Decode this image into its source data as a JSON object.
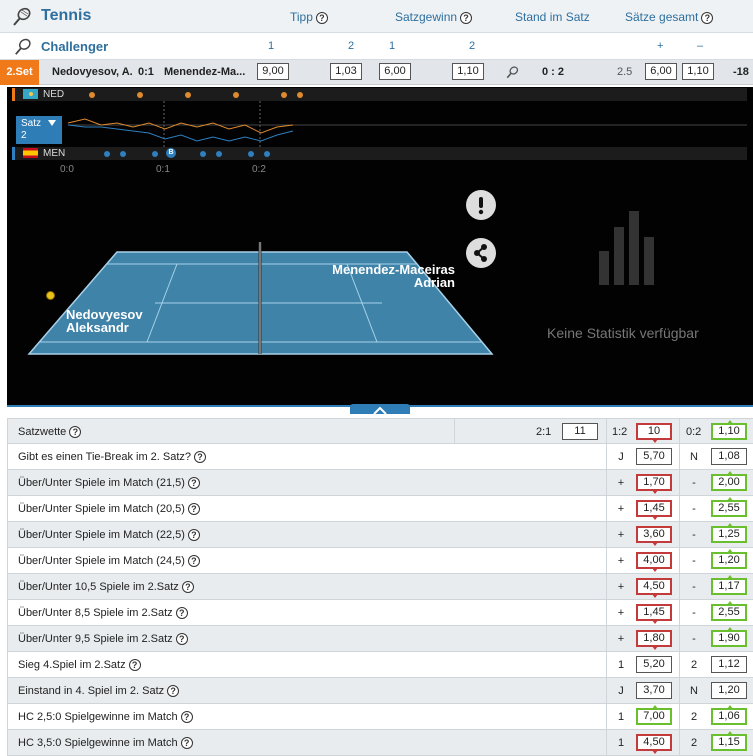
{
  "header": {
    "title": "Tennis",
    "columns": {
      "tipp": "Tipp",
      "satzgewinn": "Satzgewinn",
      "stand": "Stand im Satz",
      "saetze": "Sätze gesamt"
    },
    "help_glyph": "?"
  },
  "subheader": {
    "title": "Challenger",
    "tipp_1": "1",
    "tipp_2": "2",
    "satz_1": "1",
    "satz_2": "2",
    "plus": "+",
    "minus": "–"
  },
  "match": {
    "set_badge": "2.Set",
    "player1": "Nedovyesov, A.",
    "score": "0:1",
    "player2": "Menendez-Ma...",
    "odd_1": "9,00",
    "odd_2": "1,03",
    "satz_1": "6,00",
    "satz_2": "1,10",
    "stand": "0 : 2",
    "total": "2.5",
    "total_plus": "6,00",
    "total_minus": "1,10",
    "diff": "-18"
  },
  "field": {
    "team1_code": "NED",
    "team2_code": "MEN",
    "satz_label": "Satz",
    "satz_value": "2",
    "axis": [
      "0:0",
      "0:1",
      "0:2"
    ],
    "break_marker": "B",
    "player1_first": "Nedovyesov",
    "player1_last": "Aleksandr",
    "player2_first": "Menendez-Maceiras",
    "player2_last": "Adrian",
    "no_stats": "Keine Statistik verfügbar",
    "colors": {
      "accent": "#2f7db7",
      "orange": "#f07a1a",
      "court": "#4a9ac6"
    }
  },
  "bets": [
    {
      "label": "Satzwette",
      "a_sym": "2:1",
      "a": "11",
      "b_sym": "1:2",
      "b": "10",
      "c_sym": "0:2",
      "c": "1,10",
      "three": true,
      "a_state": "",
      "b_state": "down",
      "c_state": "up"
    },
    {
      "label": "Gibt es einen Tie-Break im 2. Satz?",
      "a_sym": "J",
      "a": "5,70",
      "b_sym": "N",
      "b": "1,08",
      "a_state": "",
      "b_state": ""
    },
    {
      "label": "Über/Unter Spiele im Match (21,5)",
      "a_sym": "+",
      "a": "1,70",
      "b_sym": "-",
      "b": "2,00",
      "a_state": "down",
      "b_state": "up"
    },
    {
      "label": "Über/Unter Spiele im Match (20,5)",
      "a_sym": "+",
      "a": "1,45",
      "b_sym": "-",
      "b": "2,55",
      "a_state": "down",
      "b_state": "up"
    },
    {
      "label": "Über/Unter Spiele im Match (22,5)",
      "a_sym": "+",
      "a": "3,60",
      "b_sym": "-",
      "b": "1,25",
      "a_state": "down",
      "b_state": "up"
    },
    {
      "label": "Über/Unter Spiele im Match (24,5)",
      "a_sym": "+",
      "a": "4,00",
      "b_sym": "-",
      "b": "1,20",
      "a_state": "down",
      "b_state": "up"
    },
    {
      "label": "Über/Unter 10,5 Spiele im 2.Satz",
      "a_sym": "+",
      "a": "4,50",
      "b_sym": "-",
      "b": "1,17",
      "a_state": "down",
      "b_state": "up"
    },
    {
      "label": "Über/Unter 8,5 Spiele im 2.Satz",
      "a_sym": "+",
      "a": "1,45",
      "b_sym": "-",
      "b": "2,55",
      "a_state": "down",
      "b_state": "up"
    },
    {
      "label": "Über/Unter 9,5 Spiele im 2.Satz",
      "a_sym": "+",
      "a": "1,80",
      "b_sym": "-",
      "b": "1,90",
      "a_state": "down",
      "b_state": "up"
    },
    {
      "label": "Sieg 4.Spiel im 2.Satz",
      "a_sym": "1",
      "a": "5,20",
      "b_sym": "2",
      "b": "1,12",
      "a_state": "",
      "b_state": ""
    },
    {
      "label": "Einstand in 4. Spiel im 2. Satz",
      "a_sym": "J",
      "a": "3,70",
      "b_sym": "N",
      "b": "1,20",
      "a_state": "",
      "b_state": ""
    },
    {
      "label": "HC 2,5:0 Spielgewinne im Match",
      "a_sym": "1",
      "a": "7,00",
      "b_sym": "2",
      "b": "1,06",
      "a_state": "up",
      "b_state": "up"
    },
    {
      "label": "HC 3,5:0 Spielgewinne im Match",
      "a_sym": "1",
      "a": "4,50",
      "b_sym": "2",
      "b": "1,15",
      "a_state": "down",
      "b_state": "up"
    }
  ]
}
